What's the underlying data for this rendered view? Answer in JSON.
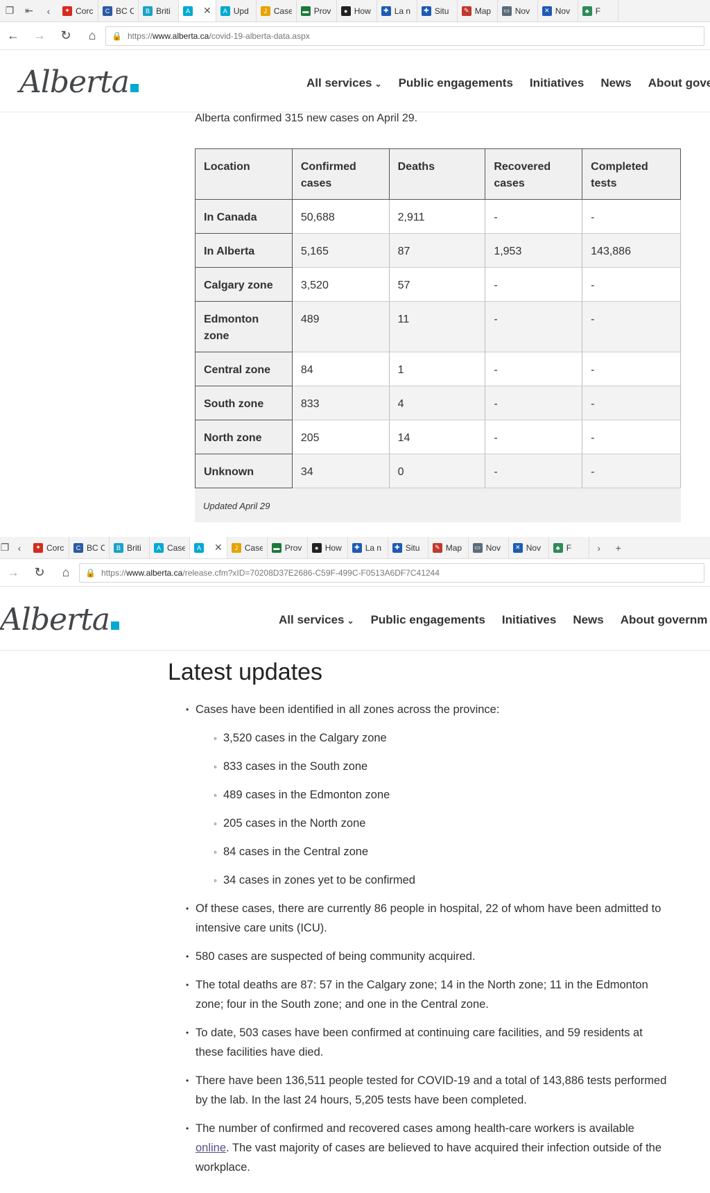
{
  "window1": {
    "tabs": [
      {
        "label": "Corc",
        "color": "#d52b1e",
        "glyph": "✦"
      },
      {
        "label": "BC C",
        "color": "#2a5aa3",
        "glyph": "C"
      },
      {
        "label": "Briti",
        "color": "#1aa3c8",
        "glyph": "B"
      },
      {
        "label": "",
        "color": "#00aad2",
        "glyph": "A",
        "active": true
      },
      {
        "label": "Upd",
        "color": "#00aad2",
        "glyph": "A"
      },
      {
        "label": "Case",
        "color": "#e5a400",
        "glyph": "J"
      },
      {
        "label": "Prov",
        "color": "#1b7a3a",
        "glyph": "▬"
      },
      {
        "label": "How",
        "color": "#222222",
        "glyph": "●"
      },
      {
        "label": "La n",
        "color": "#1d5bb3",
        "glyph": "✚"
      },
      {
        "label": "Situ",
        "color": "#1d5bb3",
        "glyph": "✚"
      },
      {
        "label": "Map",
        "color": "#c0392b",
        "glyph": "✎"
      },
      {
        "label": "Nov",
        "color": "#5b6b7a",
        "glyph": "▭"
      },
      {
        "label": "Nov",
        "color": "#1d5bb3",
        "glyph": "✕"
      },
      {
        "label": "F",
        "color": "#2e8b57",
        "glyph": "♣"
      }
    ],
    "url_prefix": "https://",
    "url_domain": "www.alberta.ca",
    "url_path": "/covid-19-alberta-data.aspx"
  },
  "window2": {
    "tabs": [
      {
        "label": "Corc",
        "color": "#d52b1e",
        "glyph": "✦"
      },
      {
        "label": "BC C",
        "color": "#2a5aa3",
        "glyph": "C"
      },
      {
        "label": "Briti",
        "color": "#1aa3c8",
        "glyph": "B"
      },
      {
        "label": "Case",
        "color": "#00aad2",
        "glyph": "A"
      },
      {
        "label": "",
        "color": "#00aad2",
        "glyph": "A",
        "active": true
      },
      {
        "label": "Case",
        "color": "#e5a400",
        "glyph": "J"
      },
      {
        "label": "Prov",
        "color": "#1b7a3a",
        "glyph": "▬"
      },
      {
        "label": "How",
        "color": "#222222",
        "glyph": "●"
      },
      {
        "label": "La n",
        "color": "#1d5bb3",
        "glyph": "✚"
      },
      {
        "label": "Situ",
        "color": "#1d5bb3",
        "glyph": "✚"
      },
      {
        "label": "Map",
        "color": "#c0392b",
        "glyph": "✎"
      },
      {
        "label": "Nov",
        "color": "#5b6b7a",
        "glyph": "▭"
      },
      {
        "label": "Nov",
        "color": "#1d5bb3",
        "glyph": "✕"
      },
      {
        "label": "F",
        "color": "#2e8b57",
        "glyph": "♣"
      }
    ],
    "url_prefix": "https://",
    "url_domain": "www.alberta.ca",
    "url_path": "/release.cfm?xID=70208D37E2686-C59F-499C-F0513A6DF7C41244"
  },
  "site": {
    "logo_text": "Alberta",
    "nav": [
      "All services",
      "Public engagements",
      "Initiatives",
      "News",
      "About gove"
    ],
    "nav2": [
      "All services",
      "Public engagements",
      "Initiatives",
      "News",
      "About governm"
    ]
  },
  "intro_text": "Alberta confirmed 315 new cases on April 29.",
  "table": {
    "headers": [
      "Location",
      "Confirmed cases",
      "Deaths",
      "Recovered cases",
      "Completed tests"
    ],
    "rows": [
      [
        "In Canada",
        "50,688",
        "2,911",
        "-",
        "-"
      ],
      [
        "In Alberta",
        "5,165",
        "87",
        "1,953",
        "143,886"
      ],
      [
        "Calgary zone",
        "3,520",
        "57",
        "-",
        "-"
      ],
      [
        "Edmonton zone",
        "489",
        "11",
        "-",
        "-"
      ],
      [
        "Central zone",
        "84",
        "1",
        "-",
        "-"
      ],
      [
        "South zone",
        "833",
        "4",
        "-",
        "-"
      ],
      [
        "North zone",
        "205",
        "14",
        "-",
        "-"
      ],
      [
        "Unknown",
        "34",
        "0",
        "-",
        "-"
      ]
    ],
    "caption": "Updated April 29"
  },
  "updates": {
    "title": "Latest updates",
    "zones_intro": "Cases have been identified in all zones across the province:",
    "zones": [
      "3,520 cases in the Calgary zone",
      "833 cases in the South zone",
      "489  cases in the Edmonton zone",
      "205 cases in the North zone",
      "84 cases in the Central zone",
      "34 cases in zones yet to be confirmed"
    ],
    "hospital": "Of these cases, there are currently 86 people in hospital, 22 of whom have been admitted to intensive care units (ICU).",
    "community": "580 cases are suspected of being community acquired.",
    "deaths": "The total deaths are 87: 57 in the Calgary zone; 14 in the North zone; 11 in the Edmonton zone; four in the South zone; and one in the Central zone.",
    "continuing_care": "To date, 503 cases have been confirmed at continuing care facilities, and 59 residents at these facilities have died.",
    "tested": "There have been 136,511 people tested for COVID-19 and a total of 143,886 tests performed by the lab. In the last 24 hours, 5,205 tests have been completed.",
    "workers_before": "The number of confirmed and recovered cases among health-care workers is available ",
    "workers_link": "online",
    "workers_after": ". The vast majority of cases are believed to have acquired their infection outside of the workplace."
  }
}
